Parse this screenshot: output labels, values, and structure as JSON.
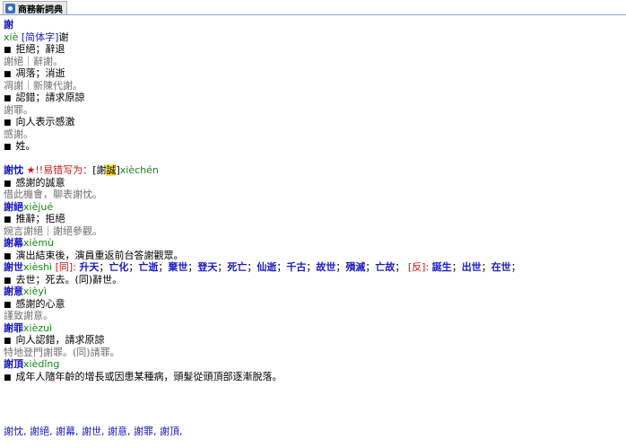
{
  "tab": {
    "label": "商務新詞典"
  },
  "entry_xie": {
    "headword": "謝",
    "pinyin": "xiè",
    "simplified_tag": "[简体字]",
    "simplified_char": "谢",
    "senses": [
      {
        "def": "拒絕；辭退",
        "example": "謝絕｜辭謝。"
      },
      {
        "def": "凋落；消逝",
        "example": "凋謝｜新陳代謝。"
      },
      {
        "def": "認錯；請求原諒",
        "example": "謝罪。"
      },
      {
        "def": "向人表示感激",
        "example": "感謝。"
      },
      {
        "def": "姓。",
        "example": ""
      }
    ]
  },
  "entry_xiechen": {
    "headword": "謝忱",
    "warning": "★!!易错写为：",
    "wrong_open": "[謝",
    "wrong_char": "誠",
    "wrong_close": "]",
    "pinyin": "xièchén",
    "def": "感謝的誠意",
    "example": "借此機會，聊表謝忱。"
  },
  "entry_xiejue": {
    "headword": "謝絕",
    "pinyin": "xièjué",
    "def": "推辭；拒絕",
    "example": "婉言謝絕｜謝絕參觀。"
  },
  "entry_xiemu": {
    "headword": "謝幕",
    "pinyin": "xièmù",
    "def": "演出結束後，演員重返前台答謝觀眾。"
  },
  "entry_xieshi": {
    "headword": "謝世",
    "pinyin": "xièshì",
    "syn_label": "[同]:",
    "synonyms": [
      "升天",
      "亡化",
      "亡逝",
      "棄世",
      "登天",
      "死亡",
      "仙逝",
      "千古",
      "故世",
      "殞滅",
      "亡故"
    ],
    "ant_label": "[反]:",
    "antonyms": [
      "誕生",
      "出世",
      "在世"
    ],
    "def": "去世；死去。(同)辭世。"
  },
  "entry_xieyi": {
    "headword": "謝意",
    "pinyin": "xièyì",
    "def": "感謝的心意",
    "example": "謹致謝意。"
  },
  "entry_xiezui": {
    "headword": "謝罪",
    "pinyin": "xièzuì",
    "def": "向人認錯，請求原諒",
    "example": "特地登門謝罪。(同)請罪。"
  },
  "entry_xieding": {
    "headword": "謝頂",
    "pinyin": "xièdǐng",
    "def": "成年人隨年齡的增長或因患某種病，頭髮從頭頂部逐漸脫落。"
  },
  "footer": {
    "links": [
      "謝忱",
      "謝絕",
      "謝幕",
      "謝世",
      "謝意",
      "謝罪",
      "謝頂"
    ]
  }
}
